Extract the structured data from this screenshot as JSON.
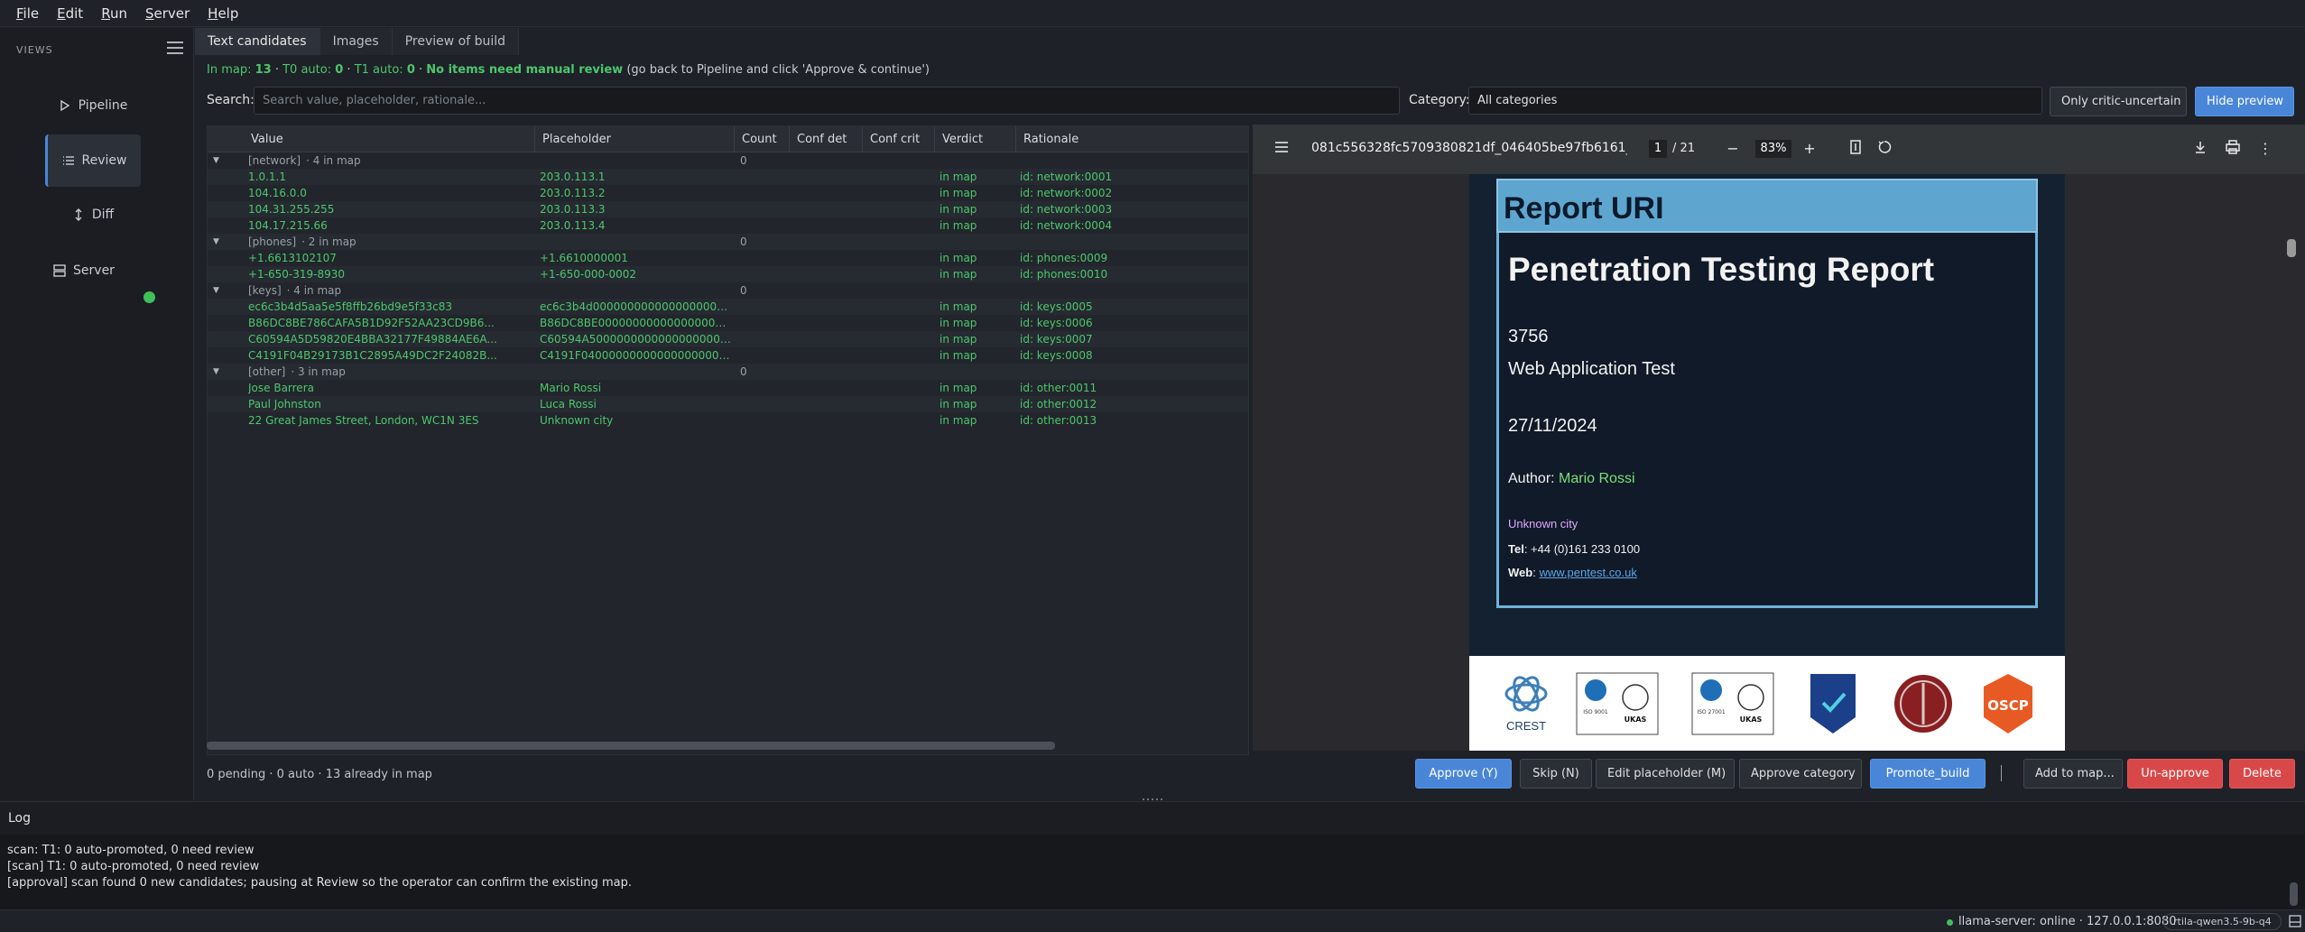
{
  "menu": [
    {
      "label": "File",
      "acc": "F",
      "rest": "ile"
    },
    {
      "label": "Edit",
      "acc": "E",
      "rest": "dit"
    },
    {
      "label": "Run",
      "acc": "R",
      "rest": "un"
    },
    {
      "label": "Server",
      "acc": "S",
      "rest": "erver"
    },
    {
      "label": "Help",
      "acc": "H",
      "rest": "elp"
    }
  ],
  "sidebar": {
    "title": "VIEWS",
    "items": [
      {
        "label": "Pipeline",
        "icon": "play-icon"
      },
      {
        "label": "Review",
        "icon": "list-icon",
        "active": true
      },
      {
        "label": "Diff",
        "icon": "diff-icon"
      },
      {
        "label": "Server",
        "icon": "server-icon",
        "status_color": "#3fbf5a"
      }
    ]
  },
  "tabs": [
    "Text candidates",
    "Images",
    "Preview of build"
  ],
  "status": {
    "in_map_label": "In map:",
    "in_map": "13",
    "t0_label": "T0 auto:",
    "t0": "0",
    "t1_label": "T1 auto:",
    "t1": "0",
    "message": "No items need manual review",
    "hint": "(go back to Pipeline and click 'Approve & continue')"
  },
  "search": {
    "label": "Search:",
    "placeholder": "Search value, placeholder, rationale..."
  },
  "category": {
    "label": "Category:",
    "value": "All categories"
  },
  "buttons": {
    "only_critic": "Only critic-uncertain",
    "hide_preview": "Hide preview"
  },
  "table": {
    "columns": [
      "Value",
      "Placeholder",
      "Count",
      "Conf det",
      "Conf crit",
      "Verdict",
      "Rationale"
    ],
    "groups": [
      {
        "name": "[network]",
        "summary": "4 in map",
        "count": "0",
        "rows": [
          {
            "value": "1.0.1.1",
            "placeholder": "203.0.113.1",
            "verdict": "in map",
            "rationale": "id: network:0001"
          },
          {
            "value": "104.16.0.0",
            "placeholder": "203.0.113.2",
            "verdict": "in map",
            "rationale": "id: network:0002"
          },
          {
            "value": "104.31.255.255",
            "placeholder": "203.0.113.3",
            "verdict": "in map",
            "rationale": "id: network:0003"
          },
          {
            "value": "104.17.215.66",
            "placeholder": "203.0.113.4",
            "verdict": "in map",
            "rationale": "id: network:0004"
          }
        ]
      },
      {
        "name": "[phones]",
        "summary": "2 in map",
        "count": "0",
        "rows": [
          {
            "value": "+1.6613102107",
            "placeholder": "+1.6610000001",
            "verdict": "in map",
            "rationale": "id: phones:0009"
          },
          {
            "value": "+1-650-319-8930",
            "placeholder": "+1-650-000-0002",
            "verdict": "in map",
            "rationale": "id: phones:0010"
          }
        ]
      },
      {
        "name": "[keys]",
        "summary": "4 in map",
        "count": "0",
        "rows": [
          {
            "value": "ec6c3b4d5aa5e5f8ffb26bd9e5f33c83",
            "placeholder": "ec6c3b4d0000000000000000000000000",
            "verdict": "in map",
            "rationale": "id: keys:0005"
          },
          {
            "value": "B86DC8BE786CAFA5B1D92F52AA23CD9B6...",
            "placeholder": "B86DC8BE00000000000000000000000000",
            "verdict": "in map",
            "rationale": "id: keys:0006"
          },
          {
            "value": "C60594A5D59820E4BBA32177F49884AE6A...",
            "placeholder": "C60594A5000000000000000000000000000",
            "verdict": "in map",
            "rationale": "id: keys:0007"
          },
          {
            "value": "C4191F04B29173B1C2895A49DC2F24082B...",
            "placeholder": "C4191F04000000000000000000000000000",
            "verdict": "in map",
            "rationale": "id: keys:0008"
          }
        ]
      },
      {
        "name": "[other]",
        "summary": "3 in map",
        "count": "0",
        "rows": [
          {
            "value": "Jose Barrera",
            "placeholder": "Mario Rossi",
            "verdict": "in map",
            "rationale": "id: other:0011"
          },
          {
            "value": "Paul Johnston",
            "placeholder": "Luca Rossi",
            "verdict": "in map",
            "rationale": "id: other:0012"
          },
          {
            "value": "22 Great James Street, London, WC1N 3ES",
            "placeholder": "Unknown city",
            "verdict": "in map",
            "rationale": "id: other:0013"
          }
        ]
      }
    ]
  },
  "preview": {
    "filename": "081c556328fc5709380821df_046405be97fb6161_du...",
    "page": "1",
    "total": "/ 21",
    "zoom": "83%",
    "doc": {
      "header": "Report URI",
      "title": "Penetration Testing Report",
      "number": "3756",
      "subtitle": "Web Application Test",
      "date": "27/11/2024",
      "author_label": "Author:",
      "author": "Mario Rossi",
      "city": "Unknown city",
      "tel_label": "Tel",
      "tel": ": +44 (0)161 233 0100",
      "web_label": "Web",
      "web": "www.pentest.co.uk"
    },
    "logos": [
      {
        "name": "crest-logo",
        "text": "CREST"
      },
      {
        "name": "iso9001-ukas-logo",
        "text": "ISO 9001 UKAS"
      },
      {
        "name": "iso27001-ukas-logo",
        "text": "ISO 27001 UKAS"
      },
      {
        "name": "cyber-essentials-plus-logo",
        "text": "CYBER ESSENTIALS CERTIFIED PLUS"
      },
      {
        "name": "seal-logo",
        "text": ""
      },
      {
        "name": "oscp-logo",
        "text": "OSCP"
      }
    ]
  },
  "footer": {
    "stats": "0 pending · 0 auto · 13 already in map",
    "buttons": {
      "approve": "Approve (Y)",
      "skip": "Skip (N)",
      "edit": "Edit placeholder (M)",
      "approve_cat": "Approve category",
      "promote": "Promote_build",
      "add_map": "Add to map...",
      "unapprove": "Un-approve",
      "delete": "Delete"
    }
  },
  "log": {
    "title": "Log",
    "lines": [
      "scan: T1: 0 auto-promoted, 0 need review",
      "[scan] T1: 0 auto-promoted, 0 need review",
      "[approval] scan found 0 new candidates; pausing at Review so the operator can confirm the existing map."
    ]
  },
  "statusbar": {
    "server": "llama-server: online · 127.0.0.1:8080",
    "model": "rtila-qwen3.5-9b-q4"
  },
  "colors": {
    "accent": "#4a86d8",
    "in_map": "#4cc76d",
    "danger": "#d94848",
    "online": "#3fbf5a"
  }
}
